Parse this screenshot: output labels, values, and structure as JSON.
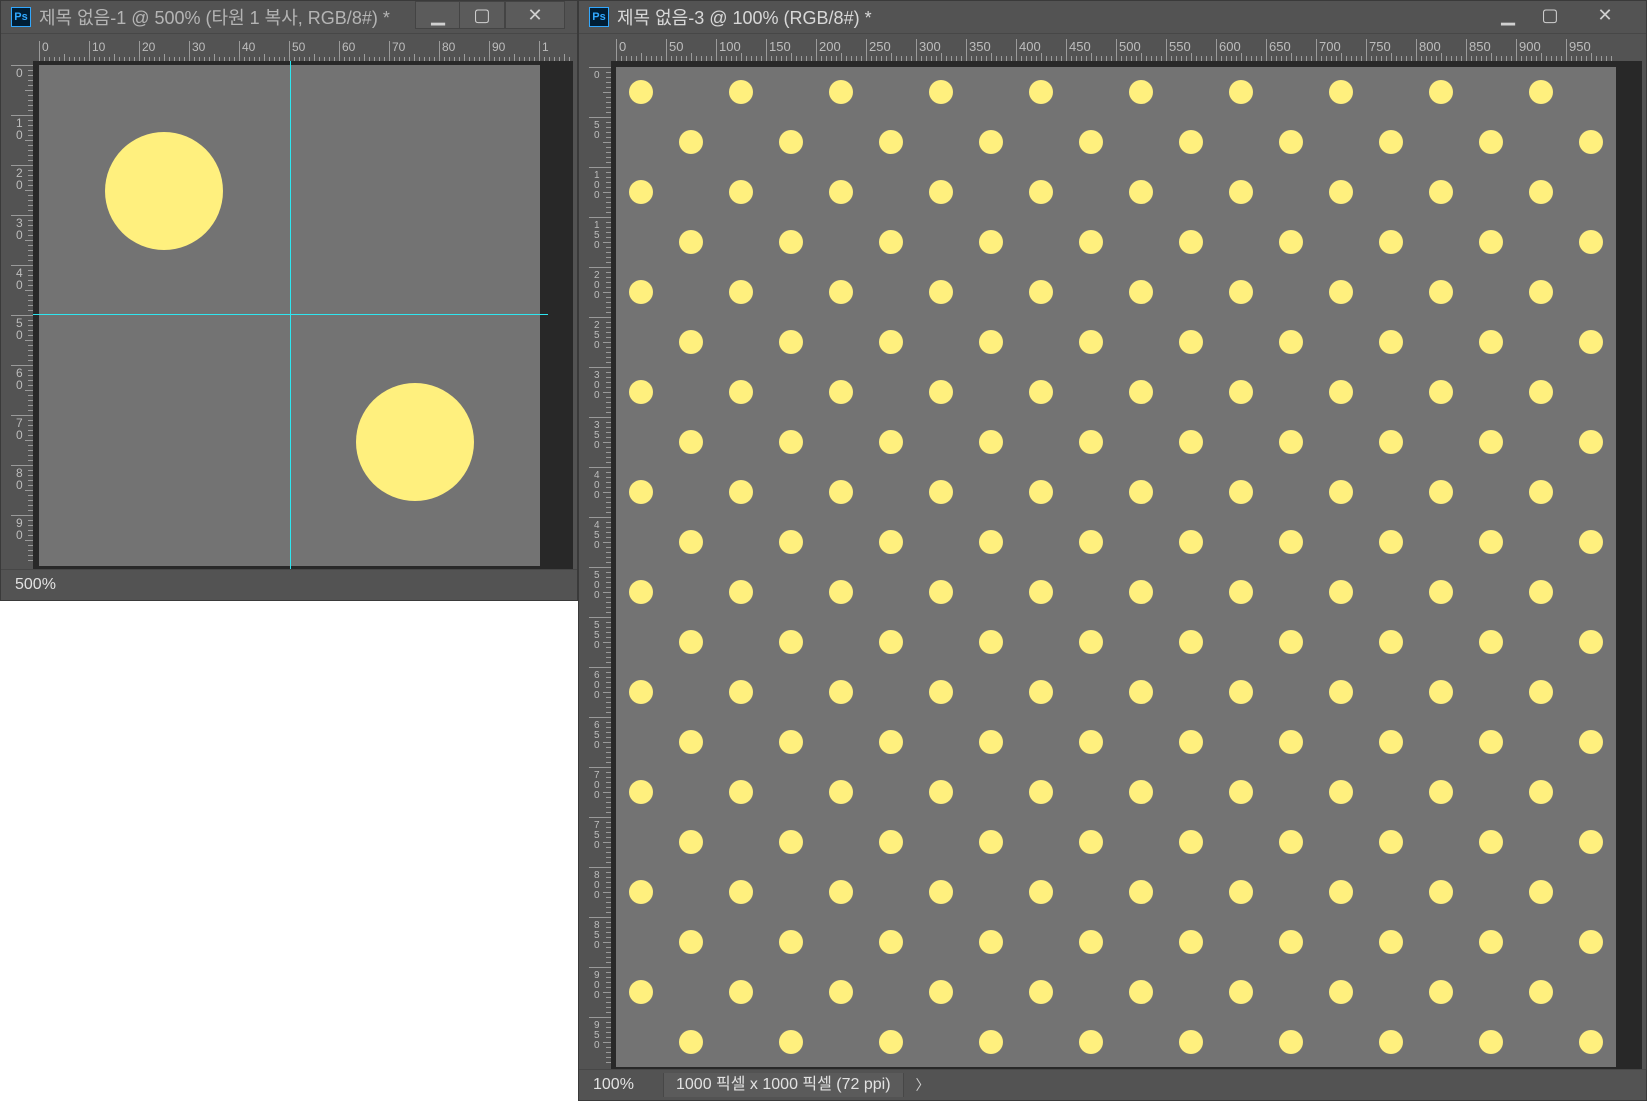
{
  "left_window": {
    "title": "제목 없음-1 @ 500% (타원 1 복사, RGB/8#) *",
    "ps_label": "Ps",
    "controls": {
      "minimize_icon": "minimize-icon",
      "maximize_icon": "maximize-icon",
      "close_icon": "close-icon"
    },
    "ruler_top_ticks": [
      "0",
      "10",
      "20",
      "30",
      "40",
      "50",
      "60",
      "70",
      "80",
      "90",
      "1"
    ],
    "ruler_left_ticks": [
      "0",
      "1 0",
      "2 0",
      "3 0",
      "4 0",
      "5 0",
      "6 0",
      "7 0",
      "8 0",
      "9 0"
    ],
    "zoom": "500%",
    "canvas_color": "#737373",
    "dot_color": "#fff07e",
    "guide_color": "#2ee6f0"
  },
  "right_window": {
    "title": "제목 없음-3 @ 100% (RGB/8#) *",
    "ps_label": "Ps",
    "controls": {
      "minimize_icon": "minimize-icon",
      "maximize_icon": "maximize-icon",
      "close_icon": "close-icon"
    },
    "ruler_top_ticks": [
      "0",
      "50",
      "100",
      "150",
      "200",
      "250",
      "300",
      "350",
      "400",
      "450",
      "500",
      "550",
      "600",
      "650",
      "700",
      "750",
      "800",
      "850",
      "900",
      "950"
    ],
    "ruler_left_ticks": [
      "0",
      "5 0",
      "1 0 0",
      "1 5 0",
      "2 0 0",
      "2 5 0",
      "3 0 0",
      "3 5 0",
      "4 0 0",
      "4 5 0",
      "5 0 0",
      "5 5 0",
      "6 0 0",
      "6 5 0",
      "7 0 0",
      "7 5 0",
      "8 0 0",
      "8 5 0",
      "9 0 0",
      "9 5 0"
    ],
    "zoom": "100%",
    "doc_info": "1000 픽셀 x 1000 픽셀 (72 ppi)",
    "chevron": "〉",
    "canvas_color": "#737373",
    "dot_color": "#fff07e"
  }
}
